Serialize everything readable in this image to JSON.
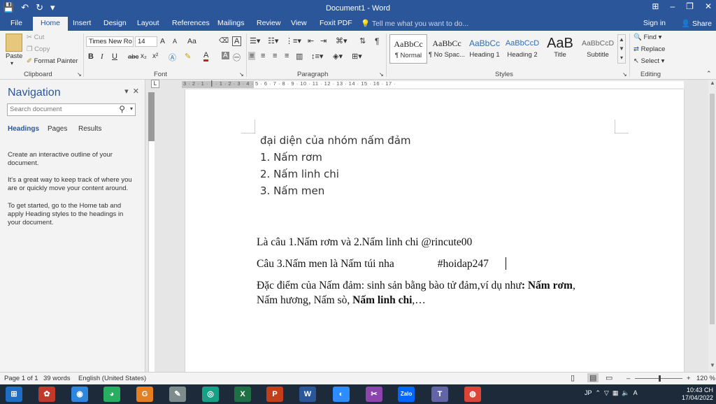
{
  "titlebar": {
    "title": "Document1 - Word",
    "qat": {
      "save_icon": "💾",
      "undo_icon": "↶",
      "redo_icon": "↻",
      "more_icon": "▾"
    },
    "window_controls": {
      "restore_ribbon": "⊞",
      "minimize": "–",
      "maximize": "❐",
      "close": "✕"
    }
  },
  "tabs": [
    {
      "label": "File"
    },
    {
      "label": "Home"
    },
    {
      "label": "Insert"
    },
    {
      "label": "Design"
    },
    {
      "label": "Layout"
    },
    {
      "label": "References"
    },
    {
      "label": "Mailings"
    },
    {
      "label": "Review"
    },
    {
      "label": "View"
    },
    {
      "label": "Foxit PDF"
    }
  ],
  "tell_me": "Tell me what you want to do...",
  "sign_in": "Sign in",
  "share": "Share",
  "clipboard": {
    "paste": "Paste",
    "cut": "Cut",
    "copy": "Copy",
    "format_painter": "Format Painter",
    "label": "Clipboard"
  },
  "font": {
    "family": "Times New Ro",
    "size": "14",
    "grow": "A",
    "shrink": "A",
    "case": "Aa",
    "bold": "B",
    "italic": "I",
    "underline": "U",
    "strike": "abc",
    "sub": "x₂",
    "sup": "x²",
    "label": "Font"
  },
  "paragraph": {
    "label": "Paragraph",
    "pilcrow": "¶"
  },
  "styles": {
    "label": "Styles",
    "items": [
      {
        "preview": "AaBbCc",
        "name": "¶ Normal"
      },
      {
        "preview": "AaBbCc",
        "name": "¶ No Spac..."
      },
      {
        "preview": "AaBbCc",
        "name": "Heading 1"
      },
      {
        "preview": "AaBbCcD",
        "name": "Heading 2"
      },
      {
        "preview": "AaB",
        "name": "Title"
      },
      {
        "preview": "AaBbCcD",
        "name": "Subtitle"
      }
    ]
  },
  "editing": {
    "find": "Find",
    "replace": "Replace",
    "select": "Select",
    "label": "Editing"
  },
  "nav": {
    "title": "Navigation",
    "search_placeholder": "Search document",
    "tabs": [
      "Headings",
      "Pages",
      "Results"
    ],
    "tips": [
      "Create an interactive outline of your document.",
      "It's a great way to keep track of where you are or quickly move your content around.",
      "To get started, go to the Home tab and apply Heading styles to the headings in your document."
    ]
  },
  "ruler": {
    "numbers": "3 · 2 · 1 · ┃ · 1 · 2 · 3 · 4 · 5 · 6 · 7 · 8 · 9 · 10 · 11 · 12 · 13 · 14 · 15 · 16 · 17 ·",
    "tab_selector": "L"
  },
  "document": {
    "lines_sans": [
      "đại diện của nhóm nấm đảm",
      "1. Nấm rơm",
      "2. Nấm linh chi",
      "3. Nấm men"
    ],
    "line_a": "Là câu 1.Nấm rơm và 2.Nấm linh chi   @rincute00",
    "line_b_left": "Câu 3.Nấm men là Nấm túi nha",
    "line_b_tag": "#hoidap247",
    "line_c1_normal": "Đặc điểm của Nấm đảm: sinh sản bằng bào tử đảm,ví dụ như",
    "line_c1_bold": ": Nấm rơm",
    "line_c1_tail": ",",
    "line_c2_normal": "Nấm hương, Nấm sò, ",
    "line_c2_bold": "Nấm linh chi",
    "line_c2_tail": ",…"
  },
  "status": {
    "page": "Page 1 of 1",
    "words": "39 words",
    "language": "English (United States)",
    "zoom": "120 %"
  },
  "taskbar": {
    "time": "10:43 CH",
    "date": "17/04/2022",
    "lang": "JP",
    "apps": [
      {
        "name": "start",
        "glyph": "⊞",
        "color": "#1e6fc4"
      },
      {
        "name": "app-lotus",
        "glyph": "✿",
        "color": "#c0392b"
      },
      {
        "name": "app-owl",
        "glyph": "◉",
        "color": "#2e86de"
      },
      {
        "name": "chrome-alt",
        "glyph": "◕",
        "color": "#27ae60"
      },
      {
        "name": "foxit",
        "glyph": "G",
        "color": "#e67e22"
      },
      {
        "name": "paint",
        "glyph": "✎",
        "color": "#7f8c8d"
      },
      {
        "name": "cam",
        "glyph": "◎",
        "color": "#16a085"
      },
      {
        "name": "excel",
        "glyph": "X",
        "color": "#1e7145"
      },
      {
        "name": "powerpoint",
        "glyph": "P",
        "color": "#c43e1c"
      },
      {
        "name": "word",
        "glyph": "W",
        "color": "#2b579a"
      },
      {
        "name": "zoom",
        "glyph": "◐",
        "color": "#2d8cff"
      },
      {
        "name": "snip",
        "glyph": "✂",
        "color": "#8e44ad"
      },
      {
        "name": "zalo",
        "glyph": "Zalo",
        "color": "#0068ff"
      },
      {
        "name": "teams",
        "glyph": "T",
        "color": "#6264a7"
      },
      {
        "name": "chrome",
        "glyph": "◍",
        "color": "#db4437"
      }
    ]
  }
}
